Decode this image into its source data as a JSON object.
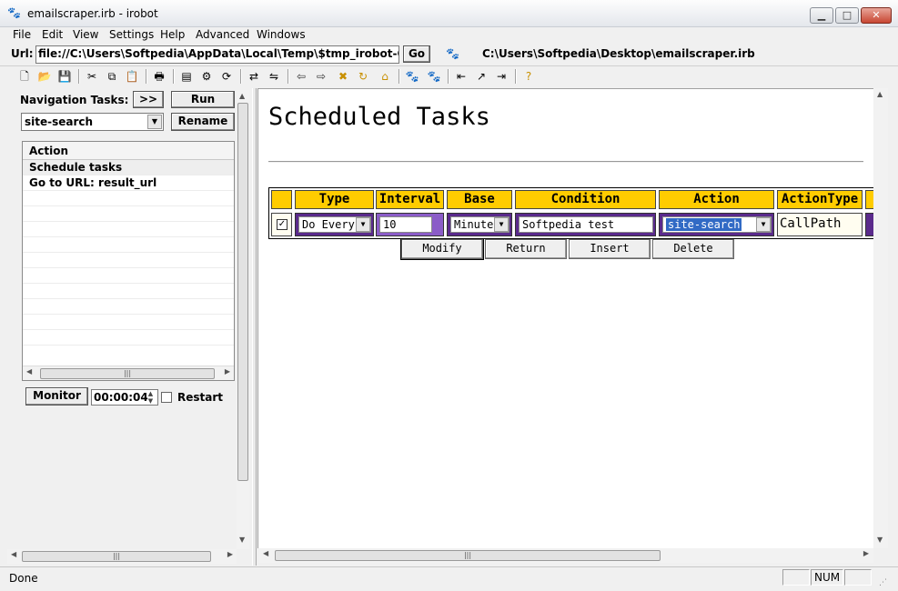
{
  "window": {
    "title": "emailscraper.irb - irobot",
    "min_glyph": "▁",
    "max_glyph": "□",
    "close_glyph": "✕"
  },
  "menu": {
    "items": [
      "File",
      "Edit",
      "View",
      "Settings",
      "Help",
      "Advanced",
      "Windows"
    ]
  },
  "urlbar": {
    "label": "Url:",
    "value": "file://C:\\Users\\Softpedia\\AppData\\Local\\Temp\\$tmp_irobot-CLi",
    "go_label": "Go",
    "file_path": "C:\\Users\\Softpedia\\Desktop\\emailscraper.irb"
  },
  "left_panel": {
    "nav_label": "Navigation Tasks:",
    "expand_label": ">>",
    "run_label": "Run",
    "rename_label": "Rename",
    "selected_task": "site-search",
    "list_header": "Action",
    "list_items": [
      "Schedule tasks",
      "Go to URL: result_url"
    ],
    "monitor_label": "Monitor",
    "interval_value": "00:00:04",
    "restart_label": "Restart"
  },
  "content": {
    "title": "Scheduled Tasks",
    "columns": [
      "Type",
      "Interval",
      "Base",
      "Condition",
      "Action",
      "ActionType"
    ],
    "row": {
      "type": "Do Every",
      "interval": "10",
      "base": "Minute",
      "condition": "Softpedia test",
      "action": "site-search",
      "action_type": "CallPath"
    },
    "buttons": {
      "modify": "Modify",
      "return": "Return",
      "insert": "Insert",
      "delete": "Delete"
    }
  },
  "status": {
    "text": "Done",
    "num": "NUM"
  },
  "colors": {
    "header_bg": "#ffcc00",
    "cell_border": "#5a2a8c",
    "selection": "#316ac5"
  }
}
